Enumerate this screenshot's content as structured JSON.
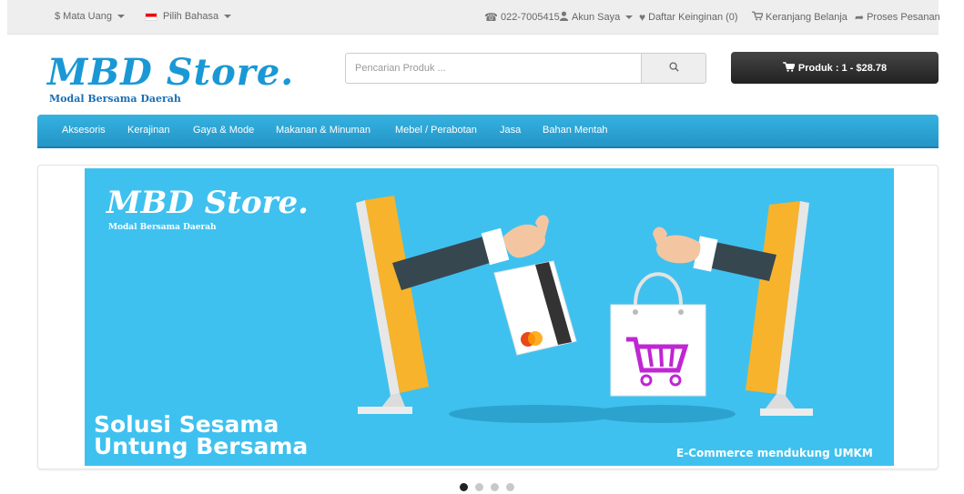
{
  "topbar": {
    "currency": "$ Mata Uang",
    "language": "Pilih Bahasa",
    "phone": "022-7005415",
    "account": "Akun Saya",
    "wishlist": "Daftar Keinginan (0)",
    "cart": "Keranjang Belanja",
    "checkout": "Proses Pesanan"
  },
  "header": {
    "logo_title": "MBD Store.",
    "logo_subtitle": "Modal Bersama Daerah",
    "search_placeholder": "Pencarian Produk ...",
    "search_value": "",
    "cart_button": "Produk : 1 - $28.78"
  },
  "nav": {
    "items": [
      "Aksesoris",
      "Kerajinan",
      "Gaya & Mode",
      "Makanan & Minuman",
      "Mebel / Perabotan",
      "Jasa",
      "Bahan Mentah"
    ]
  },
  "banner": {
    "logo_title": "MBD Store.",
    "logo_subtitle": "Modal Bersama Daerah",
    "tagline_line1": "Solusi Sesama",
    "tagline_line2": "Untung Bersama",
    "footer_text": "E-Commerce mendukung UMKM"
  },
  "slider": {
    "slide_count": 4,
    "active_slide": 1
  },
  "colors": {
    "accent": "#2ea6d8",
    "banner_bg": "#3fc1ef",
    "logo_blue": "#1a98d5",
    "cart_button_bg": "#2b2b2b",
    "monitor_yellow": "#f7b32b"
  },
  "icons": [
    "phone-icon",
    "user-icon",
    "heart-icon",
    "cart-icon",
    "share-icon",
    "search-icon"
  ]
}
